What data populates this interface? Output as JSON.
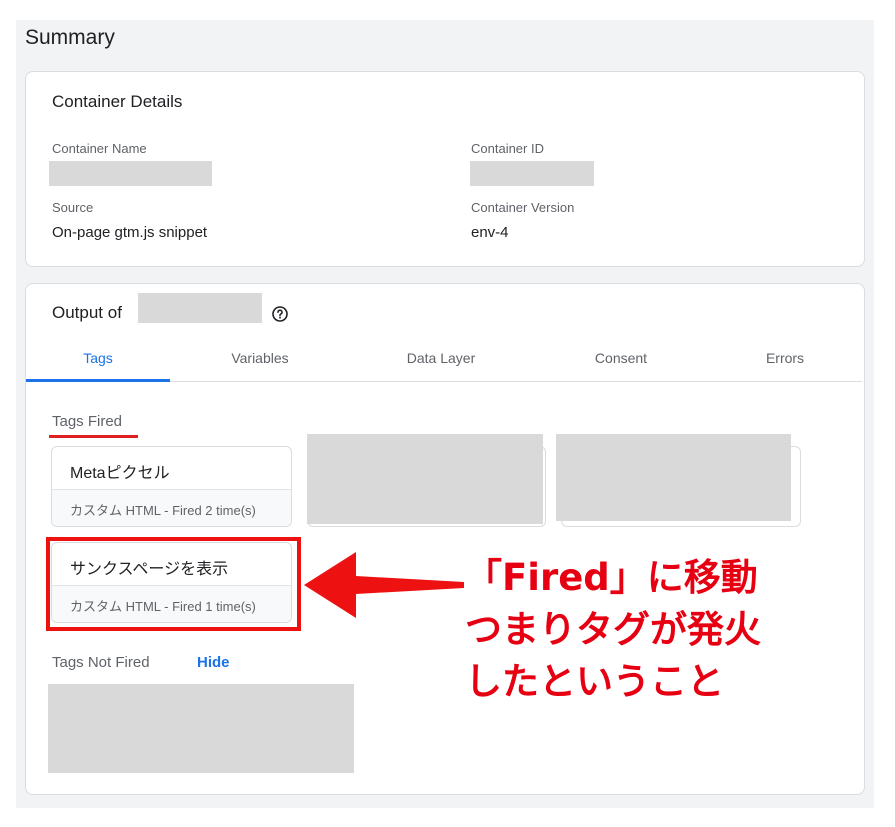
{
  "summary_title": "Summary",
  "container_details": {
    "heading": "Container Details",
    "name_label": "Container Name",
    "id_label": "Container ID",
    "source_label": "Source",
    "source_value": "On-page gtm.js snippet",
    "version_label": "Container Version",
    "version_value": "env-4"
  },
  "output": {
    "heading_prefix": "Output of",
    "tabs": [
      "Tags",
      "Variables",
      "Data Layer",
      "Consent",
      "Errors"
    ],
    "active_tab": "Tags",
    "tags_fired_label": "Tags Fired",
    "fired_tags": [
      {
        "name": "Metaピクセル",
        "status": "カスタム HTML - Fired 2 time(s)"
      },
      {
        "name": "サンクスページを表示",
        "status": "カスタム HTML - Fired 1 time(s)"
      }
    ],
    "tags_not_fired_label": "Tags Not Fired",
    "hide_label": "Hide"
  },
  "annotation": {
    "lines": [
      "「Fired」に移動",
      "つまりタグが発火",
      "したということ"
    ],
    "color": "#e60012"
  },
  "colors": {
    "accent": "#1a73e8",
    "highlight": "#ee1111"
  }
}
